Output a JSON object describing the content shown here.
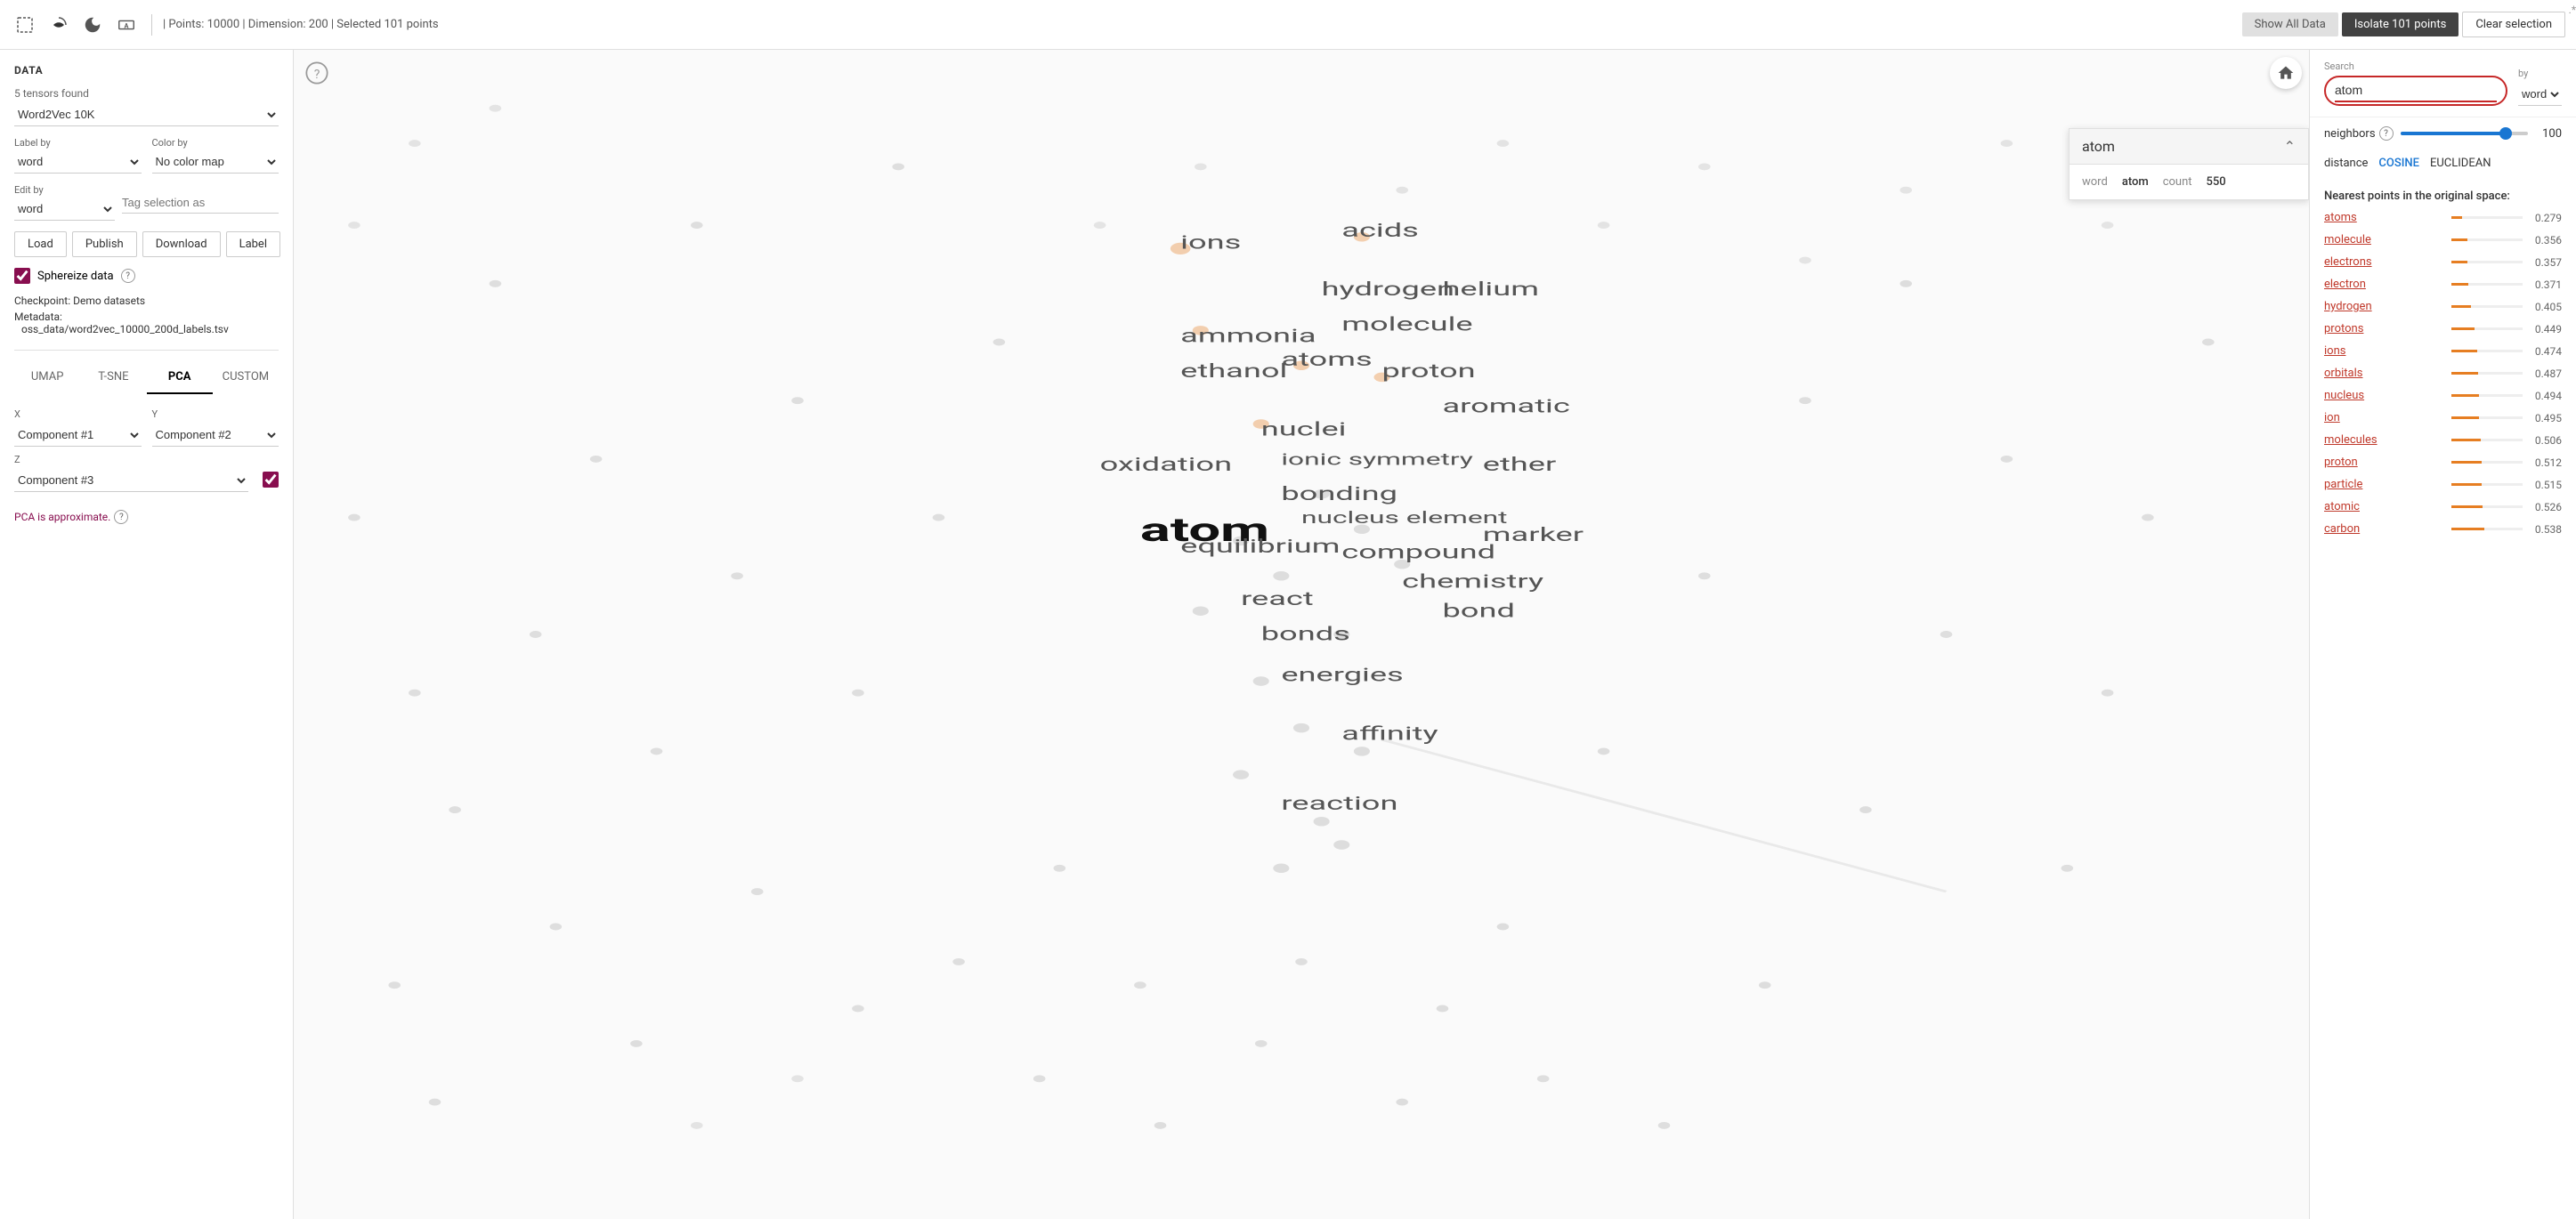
{
  "topbar": {
    "info": "| Points: 10000 | Dimension: 200 | Selected 101 points",
    "show_all": "Show All Data",
    "isolate": "Isolate 101 points",
    "clear": "Clear selection"
  },
  "sidebar": {
    "title": "DATA",
    "tensors_label": "5 tensors found",
    "tensor_value": "Word2Vec 10K",
    "label_by": "word",
    "color_by": "No color map",
    "edit_by": "word",
    "tag_placeholder": "Tag selection as",
    "load": "Load",
    "publish": "Publish",
    "download": "Download",
    "label": "Label",
    "sphereize": "Sphereize data",
    "checkpoint": "Checkpoint:",
    "checkpoint_val": "Demo datasets",
    "metadata": "Metadata:",
    "metadata_val": "oss_data/word2vec_10000_200d_labels.tsv",
    "proj_tabs": [
      "UMAP",
      "T-SNE",
      "PCA",
      "CUSTOM"
    ],
    "active_tab": "PCA",
    "x_label": "X",
    "y_label": "Y",
    "x_val": "Component #1",
    "y_val": "Component #2",
    "z_label": "Z",
    "z_val": "Component #3",
    "approx_note": "PCA is approximate."
  },
  "atom_popup": {
    "title": "atom",
    "word_key": "word",
    "word_val": "atom",
    "count_key": "count",
    "count_val": "550"
  },
  "search": {
    "label": "Search",
    "value": "atom",
    "regex": ".*",
    "by_label": "by",
    "by_value": "word"
  },
  "neighbors": {
    "label": "neighbors",
    "value": 100,
    "slider_pct": 80
  },
  "distance": {
    "label": "distance",
    "cosine": "COSINE",
    "euclidean": "EUCLIDEAN"
  },
  "nearest": {
    "header": "Nearest points in the original space:",
    "items": [
      {
        "word": "atoms",
        "value": "0.279",
        "bar_pct": 15
      },
      {
        "word": "molecule",
        "value": "0.356",
        "bar_pct": 22
      },
      {
        "word": "electrons",
        "value": "0.357",
        "bar_pct": 22
      },
      {
        "word": "electron",
        "value": "0.371",
        "bar_pct": 24
      },
      {
        "word": "hydrogen",
        "value": "0.405",
        "bar_pct": 28
      },
      {
        "word": "protons",
        "value": "0.449",
        "bar_pct": 33
      },
      {
        "word": "ions",
        "value": "0.474",
        "bar_pct": 36
      },
      {
        "word": "orbitals",
        "value": "0.487",
        "bar_pct": 38
      },
      {
        "word": "nucleus",
        "value": "0.494",
        "bar_pct": 39
      },
      {
        "word": "ion",
        "value": "0.495",
        "bar_pct": 39
      },
      {
        "word": "molecules",
        "value": "0.506",
        "bar_pct": 41
      },
      {
        "word": "proton",
        "value": "0.512",
        "bar_pct": 42
      },
      {
        "word": "particle",
        "value": "0.515",
        "bar_pct": 43
      },
      {
        "word": "atomic",
        "value": "0.526",
        "bar_pct": 44
      },
      {
        "word": "carbon",
        "value": "0.538",
        "bar_pct": 46
      }
    ]
  },
  "scatter": {
    "words": [
      {
        "text": "atom",
        "x": 47,
        "y": 40,
        "size": 22,
        "bold": true
      },
      {
        "text": "ions",
        "x": 44,
        "y": 17,
        "size": 11
      },
      {
        "text": "acids",
        "x": 53,
        "y": 16,
        "size": 11
      },
      {
        "text": "hydrogen",
        "x": 52,
        "y": 21,
        "size": 11
      },
      {
        "text": "helium",
        "x": 57,
        "y": 21,
        "size": 11
      },
      {
        "text": "ammonia",
        "x": 45,
        "y": 24,
        "size": 11
      },
      {
        "text": "molecule",
        "x": 53,
        "y": 24,
        "size": 11
      },
      {
        "text": "ethanol",
        "x": 45,
        "y": 27,
        "size": 11
      },
      {
        "text": "atoms",
        "x": 50,
        "y": 27,
        "size": 11
      },
      {
        "text": "proton",
        "x": 54,
        "y": 28,
        "size": 11
      },
      {
        "text": "aromatic",
        "x": 58,
        "y": 31,
        "size": 11
      },
      {
        "text": "nuclei",
        "x": 49,
        "y": 32,
        "size": 11
      },
      {
        "text": "ionic symmetry",
        "x": 50,
        "y": 35,
        "size": 10
      },
      {
        "text": "oxidation",
        "x": 41,
        "y": 36,
        "size": 11
      },
      {
        "text": "ether",
        "x": 59,
        "y": 36,
        "size": 11
      },
      {
        "text": "bonding",
        "x": 50,
        "y": 38,
        "size": 11
      },
      {
        "text": "nucleus element",
        "x": 51,
        "y": 40,
        "size": 10
      },
      {
        "text": "equilibrium",
        "x": 45,
        "y": 42,
        "size": 11
      },
      {
        "text": "compound",
        "x": 53,
        "y": 43,
        "size": 11
      },
      {
        "text": "marker",
        "x": 60,
        "y": 42,
        "size": 11
      },
      {
        "text": "chemistry",
        "x": 56,
        "y": 46,
        "size": 11
      },
      {
        "text": "react",
        "x": 48,
        "y": 47,
        "size": 11
      },
      {
        "text": "bond",
        "x": 58,
        "y": 48,
        "size": 11
      },
      {
        "text": "bonds",
        "x": 49,
        "y": 50,
        "size": 11
      },
      {
        "text": "energies",
        "x": 50,
        "y": 54,
        "size": 11
      },
      {
        "text": "affinity",
        "x": 53,
        "y": 59,
        "size": 11
      },
      {
        "text": "reaction",
        "x": 50,
        "y": 65,
        "size": 11
      }
    ]
  }
}
